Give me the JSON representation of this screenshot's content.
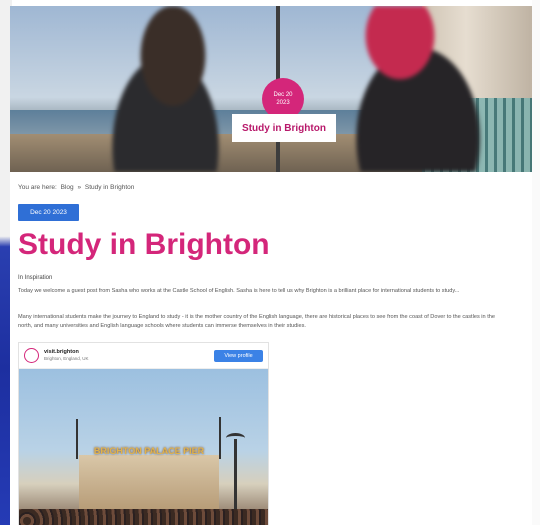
{
  "hero": {
    "date_day": "Dec 20",
    "date_year": "2023",
    "title": "Study in Brighton"
  },
  "breadcrumb": {
    "prefix": "You are here:",
    "home": "Blog",
    "separator": "»",
    "current": "Study in Brighton"
  },
  "post": {
    "date": "Dec 20 2023",
    "title": "Study in Brighton",
    "category": "In Inspiration",
    "paragraph_1": "Today we welcome a guest post from Sasha who works at the Castle School of English. Sasha is here to tell us why Brighton is a brilliant place for international students to study...",
    "paragraph_2": "Many international students make the journey to England to study - it is the mother country of the English language, there are historical places to see from the coast of Dover to the castles in the north, and many universities and English language schools where students can immerse themselves in their studies."
  },
  "embed": {
    "account": "visit.brighton",
    "location": "Brighton, England, UK",
    "view_profile": "View profile",
    "sign_text": "BRIGHTON PALACE PIER"
  },
  "colors": {
    "accent_pink": "#d4267a",
    "badge_blue": "#2f6fd6"
  }
}
